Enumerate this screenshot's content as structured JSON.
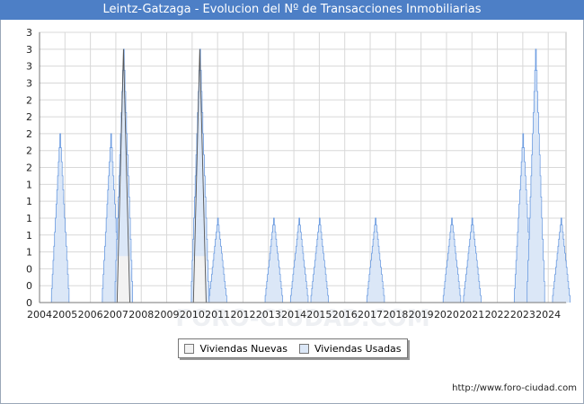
{
  "title": "Leintz-Gatzaga - Evolucion del Nº de Transacciones Inmobiliarias",
  "source": "http://www.foro-ciudad.com",
  "watermark": "FORO-CIUDAD.COM",
  "legend": {
    "nuevas_label": "Viviendas Nuevas",
    "usadas_label": "Viviendas Usadas"
  },
  "colors": {
    "title_bg": "#4d7fc6",
    "nuevas_fill": "#f2f2f2",
    "nuevas_stroke": "#555555",
    "usadas_fill": "#dbe7f7",
    "usadas_stroke": "#6b9be0",
    "grid": "#d8d8d8"
  },
  "chart_data": {
    "type": "area",
    "title": "Leintz-Gatzaga - Evolucion del Nº de Transacciones Inmobiliarias",
    "x_range": [
      2004.0,
      2024.7
    ],
    "y_range": [
      0,
      3.2
    ],
    "x_ticks": [
      "2004",
      "2005",
      "2006",
      "2007",
      "2008",
      "2009",
      "2010",
      "2011",
      "2012",
      "2013",
      "2014",
      "2015",
      "2016",
      "2017",
      "2018",
      "2019",
      "2020",
      "2021",
      "2022",
      "2023",
      "2024"
    ],
    "y_ticks": [
      {
        "v": 0.0,
        "label": "0"
      },
      {
        "v": 0.2,
        "label": "0"
      },
      {
        "v": 0.4,
        "label": "0"
      },
      {
        "v": 0.6,
        "label": "1"
      },
      {
        "v": 0.8,
        "label": "1"
      },
      {
        "v": 1.0,
        "label": "1"
      },
      {
        "v": 1.2,
        "label": "1"
      },
      {
        "v": 1.4,
        "label": "1"
      },
      {
        "v": 1.6,
        "label": "2"
      },
      {
        "v": 1.8,
        "label": "2"
      },
      {
        "v": 2.0,
        "label": "2"
      },
      {
        "v": 2.2,
        "label": "2"
      },
      {
        "v": 2.4,
        "label": "2"
      },
      {
        "v": 2.6,
        "label": "3"
      },
      {
        "v": 2.8,
        "label": "3"
      },
      {
        "v": 3.0,
        "label": "3"
      },
      {
        "v": 3.2,
        "label": "3"
      }
    ],
    "grid": true,
    "legend_position": "bottom-center",
    "series": [
      {
        "name": "Viviendas Nuevas",
        "peaks": [
          {
            "x": 2007.3,
            "y": 3
          },
          {
            "x": 2010.3,
            "y": 3
          }
        ]
      },
      {
        "name": "Viviendas Usadas",
        "peaks": [
          {
            "x": 2004.8,
            "y": 2
          },
          {
            "x": 2006.8,
            "y": 2
          },
          {
            "x": 2007.3,
            "y": 3
          },
          {
            "x": 2010.3,
            "y": 3
          },
          {
            "x": 2011.0,
            "y": 1
          },
          {
            "x": 2013.2,
            "y": 1
          },
          {
            "x": 2014.2,
            "y": 1
          },
          {
            "x": 2015.0,
            "y": 1
          },
          {
            "x": 2017.2,
            "y": 1
          },
          {
            "x": 2020.2,
            "y": 1
          },
          {
            "x": 2021.0,
            "y": 1
          },
          {
            "x": 2023.0,
            "y": 2
          },
          {
            "x": 2023.5,
            "y": 3
          },
          {
            "x": 2024.5,
            "y": 1
          }
        ]
      }
    ]
  }
}
